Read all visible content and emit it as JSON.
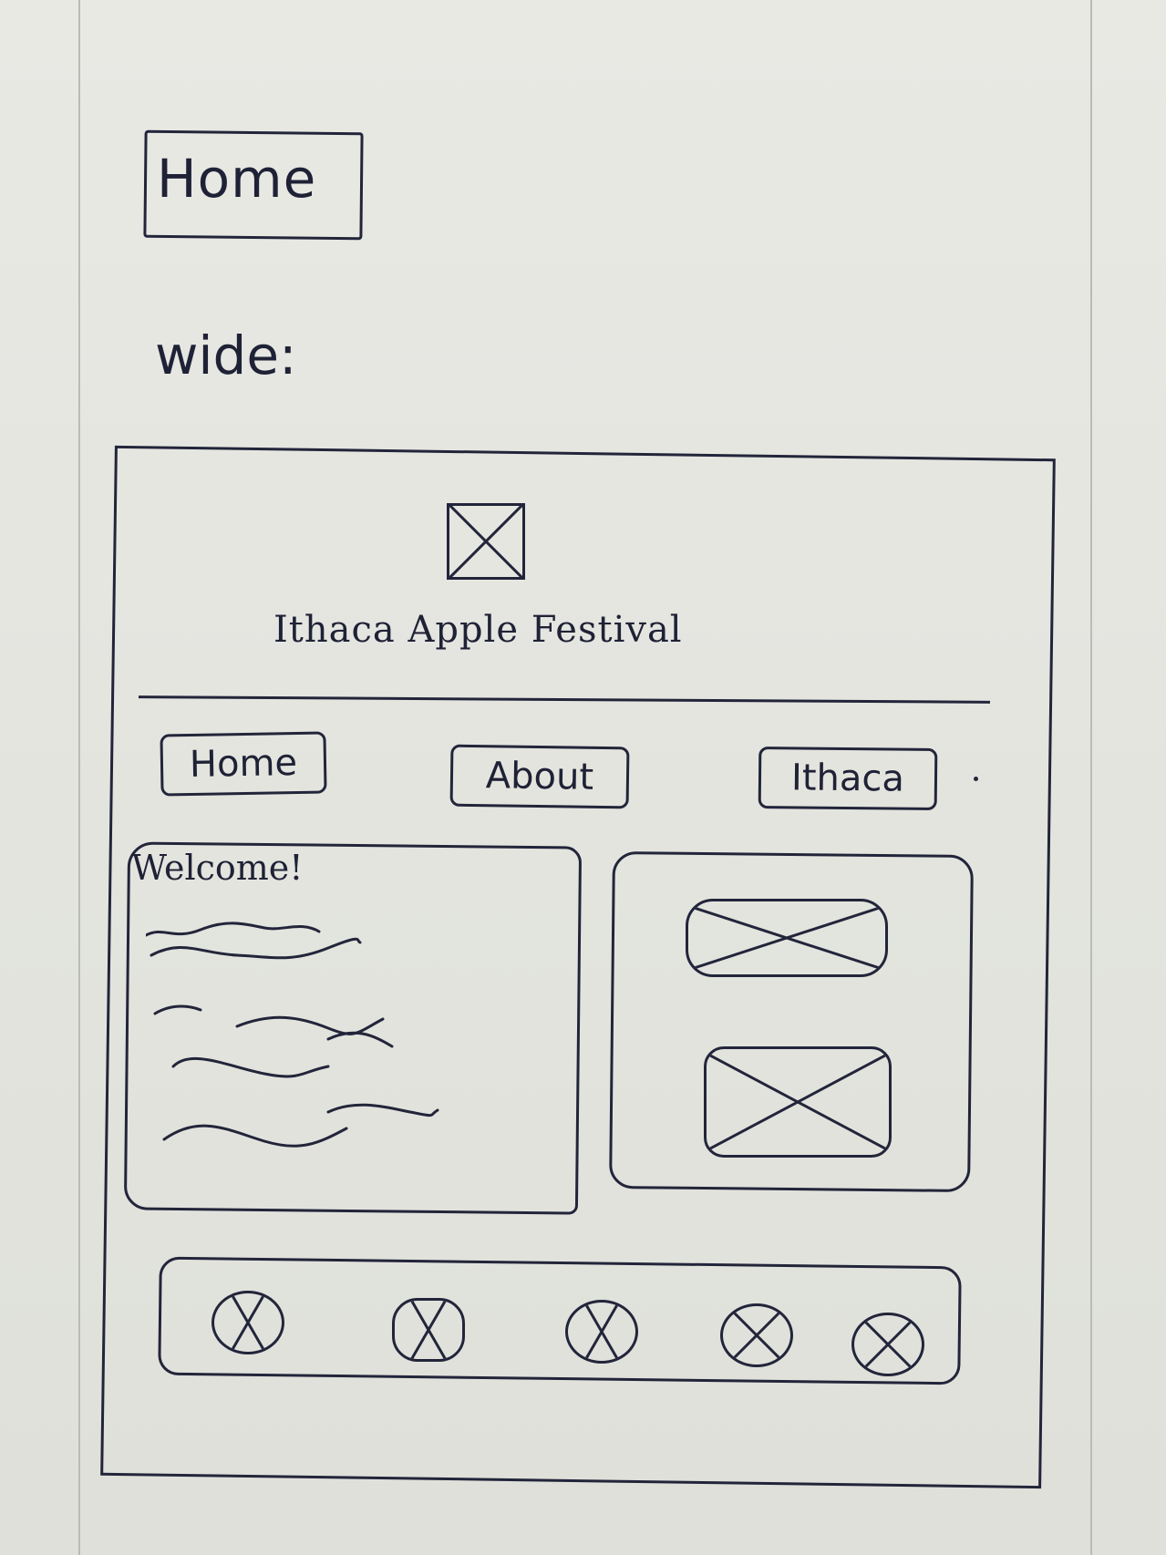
{
  "sketch": {
    "page_label": "Home",
    "variant_label": "wide:"
  },
  "wireframe": {
    "logo": {
      "icon": "image-placeholder-icon"
    },
    "site_title": "Ithaca Apple Festival",
    "nav": {
      "items": [
        {
          "label": "Home"
        },
        {
          "label": "About"
        },
        {
          "label": "Ithaca"
        }
      ]
    },
    "welcome": {
      "heading": "Welcome!"
    },
    "images": [
      {
        "icon": "image-placeholder-icon"
      },
      {
        "icon": "image-placeholder-icon"
      }
    ],
    "icon_bar": {
      "items": [
        {
          "icon": "circle-x-icon"
        },
        {
          "icon": "circle-x-icon"
        },
        {
          "icon": "circle-x-icon"
        },
        {
          "icon": "circle-x-icon"
        },
        {
          "icon": "circle-x-icon"
        }
      ]
    }
  }
}
